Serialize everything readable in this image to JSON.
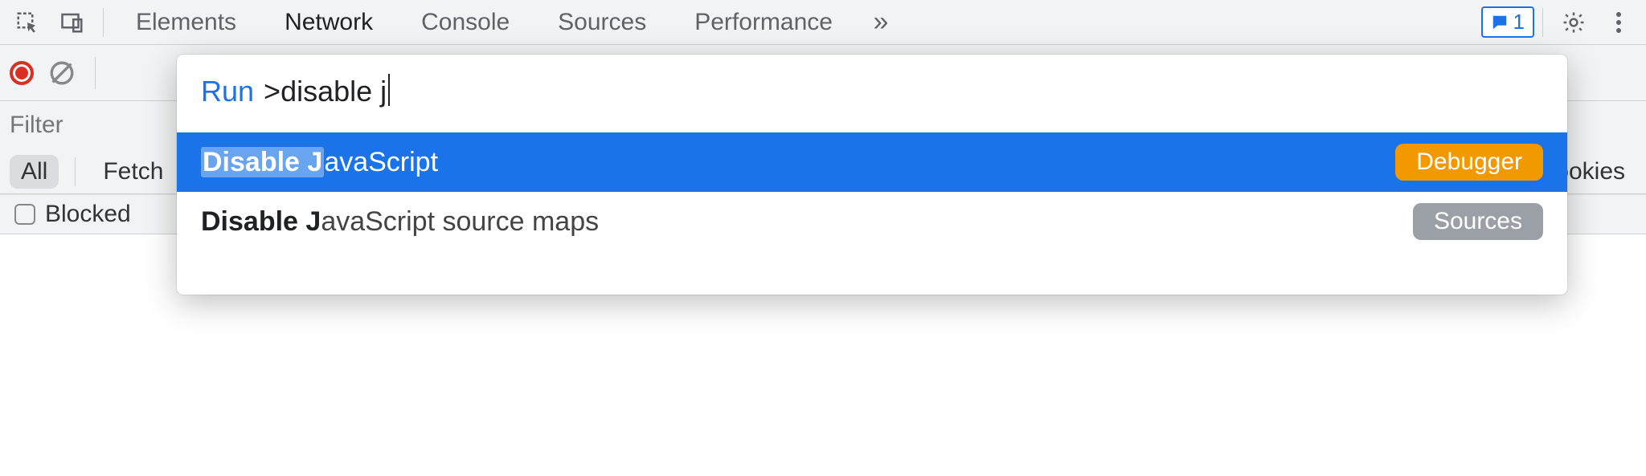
{
  "tabs": {
    "elements": "Elements",
    "network": "Network",
    "console": "Console",
    "sources": "Sources",
    "performance": "Performance",
    "active": "network"
  },
  "issues": {
    "count": "1"
  },
  "filter_placeholder": "Filter",
  "chips": {
    "all": "All",
    "fetch": "Fetch",
    "cookies_trail": "ookies"
  },
  "blocked_label": "Blocked",
  "palette": {
    "run_label": "Run",
    "query": ">disable j",
    "items": [
      {
        "cmd_bold": "Disable J",
        "cmd_rest": "avaScript",
        "badge": "Debugger",
        "badge_class": "debugger",
        "selected": true
      },
      {
        "cmd_bold": "Disable J",
        "cmd_rest": "avaScript source maps",
        "badge": "Sources",
        "badge_class": "sources",
        "selected": false
      }
    ]
  }
}
